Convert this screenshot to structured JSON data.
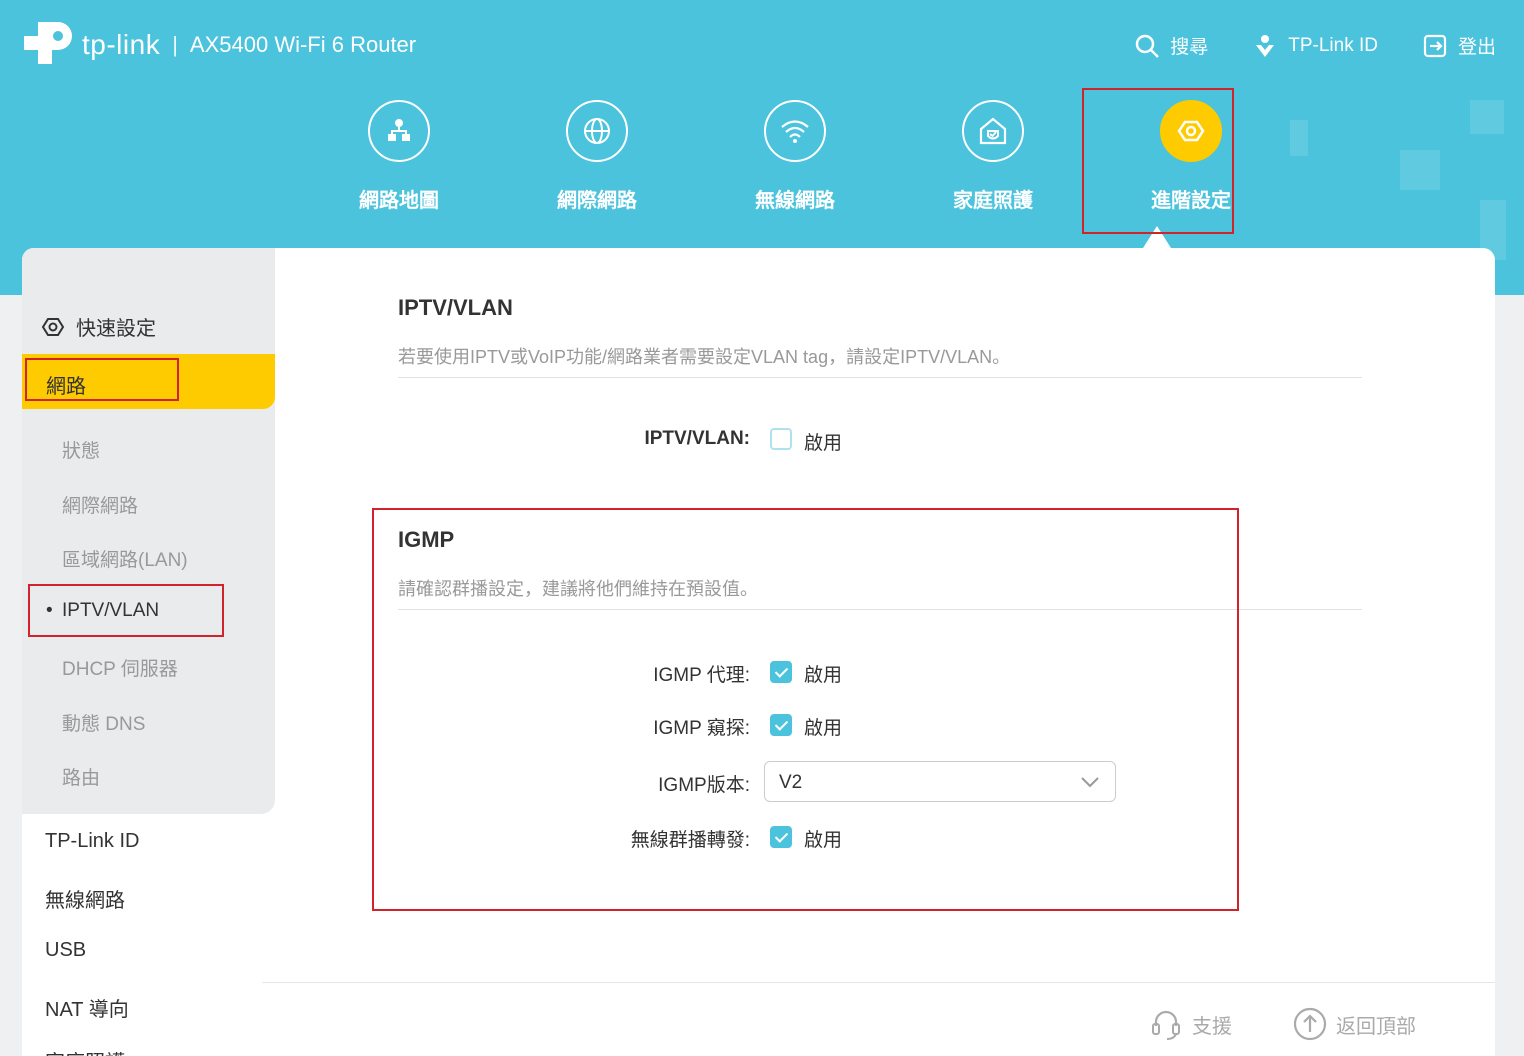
{
  "header": {
    "brand": "tp-link",
    "separator": "|",
    "model": "AX5400 Wi-Fi 6 Router",
    "links": [
      {
        "icon": "search-icon",
        "label": "搜尋"
      },
      {
        "icon": "tplink-id-icon",
        "label": "TP-Link ID"
      },
      {
        "icon": "logout-icon",
        "label": "登出"
      }
    ]
  },
  "nav": {
    "items": [
      {
        "icon": "network-map-icon",
        "label": "網路地圖"
      },
      {
        "icon": "internet-icon",
        "label": "網際網路"
      },
      {
        "icon": "wireless-icon",
        "label": "無線網路"
      },
      {
        "icon": "home-care-icon",
        "label": "家庭照護"
      },
      {
        "icon": "advanced-gear-icon",
        "label": "進階設定",
        "active": true
      }
    ]
  },
  "sidebar": {
    "quick_setup": "快速設定",
    "active_section": "網路",
    "sub_items": [
      "狀態",
      "網際網路",
      "區域網路(LAN)",
      "IPTV/VLAN",
      "DHCP 伺服器",
      "動態 DNS",
      "路由"
    ],
    "current_sub": "IPTV/VLAN",
    "sections": [
      "TP-Link ID",
      "無線網路",
      "USB",
      "NAT 導向",
      "家庭照護"
    ]
  },
  "iptv": {
    "title": "IPTV/VLAN",
    "description": "若要使用IPTV或VoIP功能/網路業者需要設定VLAN tag，請設定IPTV/VLAN。",
    "field_label": "IPTV/VLAN:",
    "enable_label": "啟用",
    "enabled": false
  },
  "igmp": {
    "title": "IGMP",
    "description": "請確認群播設定，建議將他們維持在預設值。",
    "proxy_label": "IGMP 代理:",
    "snooping_label": "IGMP 窺探:",
    "version_label": "IGMP版本:",
    "version_value": "V2",
    "wireless_multicast_label": "無線群播轉發:",
    "enable_label": "啟用",
    "proxy_enabled": true,
    "snooping_enabled": true,
    "wireless_multicast_enabled": true
  },
  "footer": {
    "support": "支援",
    "back_to_top": "返回頂部"
  },
  "colors": {
    "header_bg": "#4bc3dc",
    "accent_yellow": "#fecb00",
    "highlight_red": "#d2232a"
  }
}
